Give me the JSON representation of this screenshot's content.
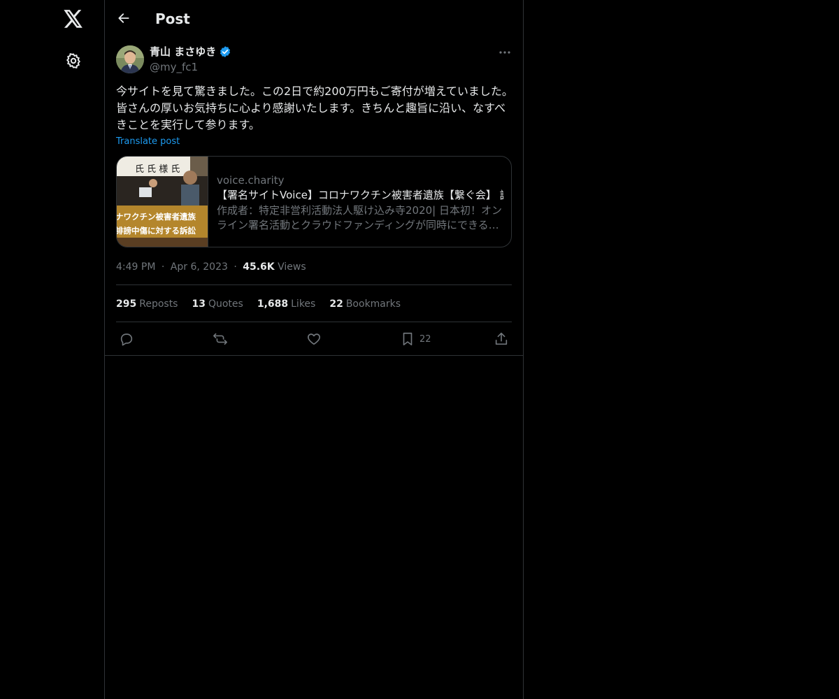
{
  "nav": {
    "logo_icon": "x-logo-icon",
    "settings_icon": "gear-icon"
  },
  "header": {
    "title": "Post",
    "back_icon": "arrow-left-icon"
  },
  "post": {
    "author_name": "青山 まさゆき",
    "verified": true,
    "author_handle": "@my_fc1",
    "text": "今サイトを見て驚きました。この2日で約200万円もご寄付が増えていました。皆さんの厚いお気持ちに心より感謝いたします。きちんと趣旨に沿い、なすべきことを実行して参ります。",
    "translate_label": "Translate post",
    "card": {
      "domain": "voice.charity",
      "title": "【署名サイトVoice】コロナワクチン被害者遺族【繋ぐ会】 誹",
      "description": "作成者：特定非営利活動法人駆け込み寺2020| 日本初！オンライン署名活動とクラウドファンディングが同時にできる…",
      "thumb_text_top": "氏 氏 様 氏",
      "thumb_text_banner1": "ナワクチン被害者遺族",
      "thumb_text_banner2": "誹謗中傷に対する訴訟"
    },
    "time": "4:49 PM",
    "date": "Apr 6, 2023",
    "views_count": "45.6K",
    "views_label": "Views",
    "separator": "·"
  },
  "stats": {
    "reposts_count": "295",
    "reposts_label": "Reposts",
    "quotes_count": "13",
    "quotes_label": "Quotes",
    "likes_count": "1,688",
    "likes_label": "Likes",
    "bookmarks_count": "22",
    "bookmarks_label": "Bookmarks"
  },
  "actions": {
    "reply_icon": "reply-icon",
    "repost_icon": "repost-icon",
    "like_icon": "heart-icon",
    "bookmark_icon": "bookmark-icon",
    "bookmark_count": "22",
    "share_icon": "share-icon"
  },
  "colors": {
    "background": "#000000",
    "text": "#e7e9ea",
    "secondary": "#71767b",
    "accent": "#1d9bf0",
    "border": "#2f3336"
  }
}
